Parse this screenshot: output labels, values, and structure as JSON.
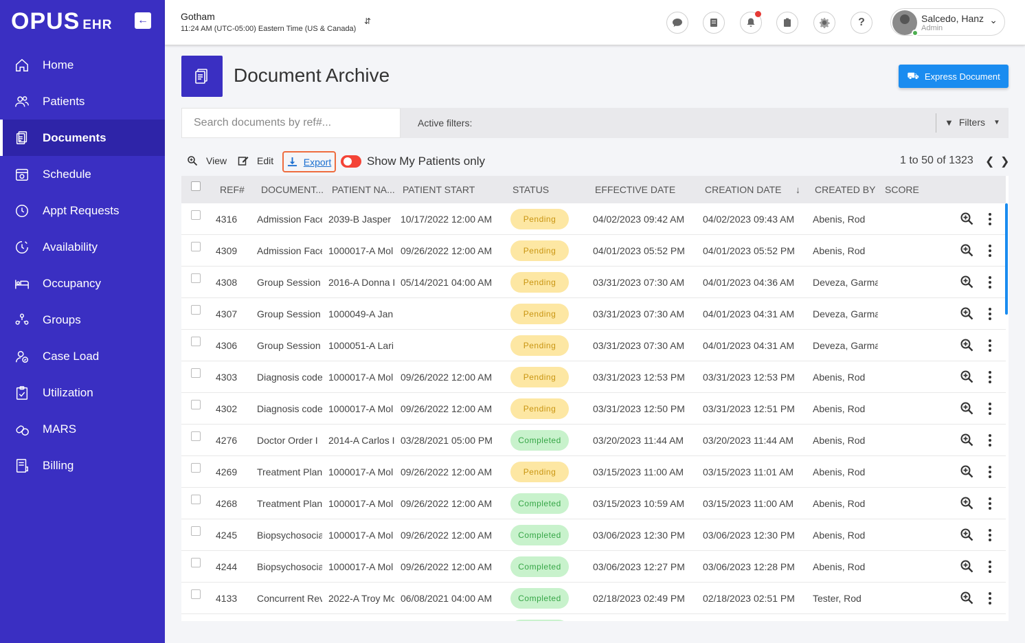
{
  "app": {
    "logo": "OPUS",
    "logo_suffix": "EHR"
  },
  "sidebar": {
    "items": [
      {
        "label": "Home",
        "icon": "home-icon",
        "active": false
      },
      {
        "label": "Patients",
        "icon": "users-icon",
        "active": false
      },
      {
        "label": "Documents",
        "icon": "documents-icon",
        "active": true
      },
      {
        "label": "Schedule",
        "icon": "calendar-icon",
        "active": false
      },
      {
        "label": "Appt Requests",
        "icon": "clock-icon",
        "active": false
      },
      {
        "label": "Availability",
        "icon": "availability-icon",
        "active": false
      },
      {
        "label": "Occupancy",
        "icon": "bed-icon",
        "active": false
      },
      {
        "label": "Groups",
        "icon": "groups-icon",
        "active": false
      },
      {
        "label": "Case Load",
        "icon": "caseload-icon",
        "active": false
      },
      {
        "label": "Utilization",
        "icon": "clipboard-check-icon",
        "active": false
      },
      {
        "label": "MARS",
        "icon": "pills-icon",
        "active": false
      },
      {
        "label": "Billing",
        "icon": "billing-icon",
        "active": false
      }
    ]
  },
  "header": {
    "org_name": "Gotham",
    "org_time": "11:24 AM (UTC-05:00) Eastern Time (US & Canada)",
    "user_name": "Salcedo, Hanz",
    "user_role": "Admin"
  },
  "page": {
    "title": "Document Archive",
    "express_button": "Express Document",
    "search_placeholder": "Search documents by ref#...",
    "active_filters_label": "Active filters:",
    "filters_button": "Filters"
  },
  "toolbar": {
    "view": "View",
    "edit": "Edit",
    "export": "Export",
    "toggle_label": "Show My Patients only",
    "pager": "1 to 50 of 1323"
  },
  "table": {
    "columns": [
      "REF#",
      "DOCUMENT...",
      "PATIENT NA...",
      "PATIENT START",
      "STATUS",
      "EFFECTIVE DATE",
      "CREATION DATE",
      "CREATED BY",
      "SCORE"
    ],
    "rows": [
      {
        "ref": "4316",
        "document": "Admission Face",
        "patient": "2039-B Jasper",
        "start": "10/17/2022 12:00 AM",
        "status": "Pending",
        "effective": "04/02/2023 09:42 AM",
        "created": "04/02/2023 09:43 AM",
        "by": "Abenis, Rod"
      },
      {
        "ref": "4309",
        "document": "Admission Face",
        "patient": "1000017-A Mol",
        "start": "09/26/2022 12:00 AM",
        "status": "Pending",
        "effective": "04/01/2023 05:52 PM",
        "created": "04/01/2023 05:52 PM",
        "by": "Abenis, Rod"
      },
      {
        "ref": "4308",
        "document": "Group Session",
        "patient": "2016-A Donna I",
        "start": "05/14/2021 04:00 AM",
        "status": "Pending",
        "effective": "03/31/2023 07:30 AM",
        "created": "04/01/2023 04:36 AM",
        "by": "Deveza, Garma"
      },
      {
        "ref": "4307",
        "document": "Group Session",
        "patient": "1000049-A Jan",
        "start": "",
        "status": "Pending",
        "effective": "03/31/2023 07:30 AM",
        "created": "04/01/2023 04:31 AM",
        "by": "Deveza, Garma"
      },
      {
        "ref": "4306",
        "document": "Group Session",
        "patient": "1000051-A Lari",
        "start": "",
        "status": "Pending",
        "effective": "03/31/2023 07:30 AM",
        "created": "04/01/2023 04:31 AM",
        "by": "Deveza, Garma"
      },
      {
        "ref": "4303",
        "document": "Diagnosis code",
        "patient": "1000017-A Mol",
        "start": "09/26/2022 12:00 AM",
        "status": "Pending",
        "effective": "03/31/2023 12:53 PM",
        "created": "03/31/2023 12:53 PM",
        "by": "Abenis, Rod"
      },
      {
        "ref": "4302",
        "document": "Diagnosis code",
        "patient": "1000017-A Mol",
        "start": "09/26/2022 12:00 AM",
        "status": "Pending",
        "effective": "03/31/2023 12:50 PM",
        "created": "03/31/2023 12:51 PM",
        "by": "Abenis, Rod"
      },
      {
        "ref": "4276",
        "document": "Doctor Order I",
        "patient": "2014-A Carlos I",
        "start": "03/28/2021 05:00 PM",
        "status": "Completed",
        "effective": "03/20/2023 11:44 AM",
        "created": "03/20/2023 11:44 AM",
        "by": "Abenis, Rod"
      },
      {
        "ref": "4269",
        "document": "Treatment Plan",
        "patient": "1000017-A Mol",
        "start": "09/26/2022 12:00 AM",
        "status": "Pending",
        "effective": "03/15/2023 11:00 AM",
        "created": "03/15/2023 11:01 AM",
        "by": "Abenis, Rod"
      },
      {
        "ref": "4268",
        "document": "Treatment Plan",
        "patient": "1000017-A Mol",
        "start": "09/26/2022 12:00 AM",
        "status": "Completed",
        "effective": "03/15/2023 10:59 AM",
        "created": "03/15/2023 11:00 AM",
        "by": "Abenis, Rod"
      },
      {
        "ref": "4245",
        "document": "Biopsychosocia",
        "patient": "1000017-A Mol",
        "start": "09/26/2022 12:00 AM",
        "status": "Completed",
        "effective": "03/06/2023 12:30 PM",
        "created": "03/06/2023 12:30 PM",
        "by": "Abenis, Rod"
      },
      {
        "ref": "4244",
        "document": "Biopsychosocia",
        "patient": "1000017-A Mol",
        "start": "09/26/2022 12:00 AM",
        "status": "Completed",
        "effective": "03/06/2023 12:27 PM",
        "created": "03/06/2023 12:28 PM",
        "by": "Abenis, Rod"
      },
      {
        "ref": "4133",
        "document": "Concurrent Rev",
        "patient": "2022-A Troy Mc",
        "start": "06/08/2021 04:00 AM",
        "status": "Completed",
        "effective": "02/18/2023 02:49 PM",
        "created": "02/18/2023 02:51 PM",
        "by": "Tester, Rod"
      },
      {
        "ref": "",
        "document": "",
        "patient": "",
        "start": "",
        "status": "Completed",
        "effective": "",
        "created": "",
        "by": ""
      }
    ]
  },
  "colors": {
    "sidebar": "#3a2fc2",
    "accent": "#1a8cf0",
    "export_outline": "#ee6c3e"
  }
}
